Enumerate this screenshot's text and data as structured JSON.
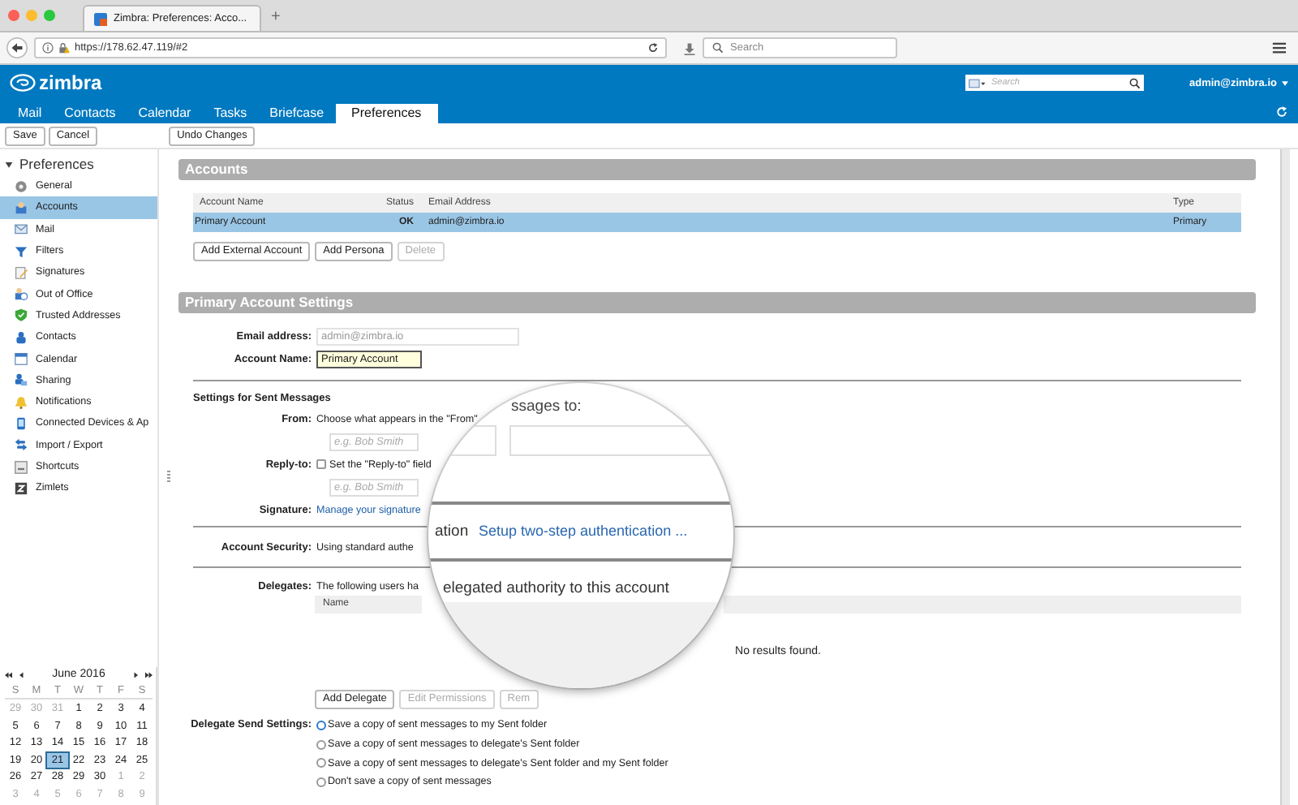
{
  "browser": {
    "tab_title": "Zimbra: Preferences: Acco...",
    "new_tab": "+",
    "url": "https://178.62.47.119/#2",
    "search_placeholder": "Search"
  },
  "header": {
    "logo": "zimbra",
    "search_placeholder": "Search",
    "user": "admin@zimbra.io"
  },
  "app_tabs": [
    {
      "label": "Mail",
      "selected": false
    },
    {
      "label": "Contacts",
      "selected": false
    },
    {
      "label": "Calendar",
      "selected": false
    },
    {
      "label": "Tasks",
      "selected": false
    },
    {
      "label": "Briefcase",
      "selected": false
    },
    {
      "label": "Preferences",
      "selected": true
    }
  ],
  "toolbar": {
    "buttons": [
      "Save",
      "Cancel"
    ],
    "undo": "Undo Changes"
  },
  "sidebar": {
    "title": "Preferences",
    "expanded": true,
    "items": [
      {
        "label": "General",
        "selected": false
      },
      {
        "label": "Accounts",
        "selected": true
      },
      {
        "label": "Mail",
        "selected": false
      },
      {
        "label": "Filters",
        "selected": false
      },
      {
        "label": "Signatures",
        "selected": false
      },
      {
        "label": "Out of Office",
        "selected": false
      },
      {
        "label": "Trusted Addresses",
        "selected": false
      },
      {
        "label": "Contacts",
        "selected": false
      },
      {
        "label": "Calendar",
        "selected": false
      },
      {
        "label": "Sharing",
        "selected": false
      },
      {
        "label": "Notifications",
        "selected": false
      },
      {
        "label": "Connected Devices & Ap",
        "selected": false
      },
      {
        "label": "Import / Export",
        "selected": false
      },
      {
        "label": "Shortcuts",
        "selected": false
      },
      {
        "label": "Zimlets",
        "selected": false
      }
    ]
  },
  "calendar": {
    "month": "June 2016",
    "weekdays": [
      "S",
      "M",
      "T",
      "W",
      "T",
      "F",
      "S"
    ],
    "weeks": [
      [
        {
          "d": "29",
          "muted": true,
          "selected": false
        },
        {
          "d": "30",
          "muted": true,
          "selected": false
        },
        {
          "d": "31",
          "muted": true,
          "selected": false
        },
        {
          "d": "1",
          "muted": false,
          "selected": false
        },
        {
          "d": "2",
          "muted": false,
          "selected": false
        },
        {
          "d": "3",
          "muted": false,
          "selected": false
        },
        {
          "d": "4",
          "muted": false,
          "selected": false
        }
      ],
      [
        {
          "d": "5",
          "muted": false,
          "selected": false
        },
        {
          "d": "6",
          "muted": false,
          "selected": false
        },
        {
          "d": "7",
          "muted": false,
          "selected": false
        },
        {
          "d": "8",
          "muted": false,
          "selected": false
        },
        {
          "d": "9",
          "muted": false,
          "selected": false
        },
        {
          "d": "10",
          "muted": false,
          "selected": false
        },
        {
          "d": "11",
          "muted": false,
          "selected": false
        }
      ],
      [
        {
          "d": "12",
          "muted": false,
          "selected": false
        },
        {
          "d": "13",
          "muted": false,
          "selected": false
        },
        {
          "d": "14",
          "muted": false,
          "selected": false
        },
        {
          "d": "15",
          "muted": false,
          "selected": false
        },
        {
          "d": "16",
          "muted": false,
          "selected": false
        },
        {
          "d": "17",
          "muted": false,
          "selected": false
        },
        {
          "d": "18",
          "muted": false,
          "selected": false
        }
      ],
      [
        {
          "d": "19",
          "muted": false,
          "selected": false
        },
        {
          "d": "20",
          "muted": false,
          "selected": false
        },
        {
          "d": "21",
          "muted": false,
          "selected": true
        },
        {
          "d": "22",
          "muted": false,
          "selected": false
        },
        {
          "d": "23",
          "muted": false,
          "selected": false
        },
        {
          "d": "24",
          "muted": false,
          "selected": false
        },
        {
          "d": "25",
          "muted": false,
          "selected": false
        }
      ],
      [
        {
          "d": "26",
          "muted": false,
          "selected": false
        },
        {
          "d": "27",
          "muted": false,
          "selected": false
        },
        {
          "d": "28",
          "muted": false,
          "selected": false
        },
        {
          "d": "29",
          "muted": false,
          "selected": false
        },
        {
          "d": "30",
          "muted": false,
          "selected": false
        },
        {
          "d": "1",
          "muted": true,
          "selected": false
        },
        {
          "d": "2",
          "muted": true,
          "selected": false
        }
      ],
      [
        {
          "d": "3",
          "muted": true,
          "selected": false
        },
        {
          "d": "4",
          "muted": true,
          "selected": false
        },
        {
          "d": "5",
          "muted": true,
          "selected": false
        },
        {
          "d": "6",
          "muted": true,
          "selected": false
        },
        {
          "d": "7",
          "muted": true,
          "selected": false
        },
        {
          "d": "8",
          "muted": true,
          "selected": false
        },
        {
          "d": "9",
          "muted": true,
          "selected": false
        }
      ]
    ]
  },
  "accounts": {
    "title": "Accounts",
    "columns": [
      "Account Name",
      "Status",
      "Email Address",
      "Type"
    ],
    "rows": [
      {
        "cells": [
          "Primary Account",
          "OK",
          "admin@zimbra.io",
          "Primary"
        ],
        "selected": true
      }
    ],
    "buttons": [
      {
        "label": "Add External Account",
        "disabled": false
      },
      {
        "label": "Add Persona",
        "disabled": false
      },
      {
        "label": "Delete",
        "disabled": true
      }
    ]
  },
  "settings": {
    "title": "Primary Account Settings",
    "email": {
      "label": "Email address:",
      "value": "admin@zimbra.io",
      "disabled": true
    },
    "account_name": {
      "label": "Account Name:",
      "value": "Primary Account"
    },
    "sent_heading": "Settings for Sent Messages",
    "from": {
      "label": "From:",
      "text": "Choose what appears in the \"From\"",
      "placeholder": "e.g. Bob Smith"
    },
    "reply_to": {
      "label": "Reply-to:",
      "checked": false,
      "text": "Set the \"Reply-to\" field",
      "placeholder": "e.g. Bob Smith"
    },
    "signature": {
      "label": "Signature:",
      "link": "Manage your signature"
    },
    "security": {
      "label": "Account Security:",
      "text": "Using standard authe"
    },
    "delegates": {
      "label": "Delegates:",
      "text": "The following users ha",
      "column": "Name",
      "empty": "No results found.",
      "buttons": [
        {
          "label": "Add Delegate",
          "disabled": false
        },
        {
          "label": "Edit Permissions",
          "disabled": true
        },
        {
          "label": "Rem",
          "disabled": true
        }
      ]
    },
    "send_settings": {
      "label": "Delegate Send Settings:",
      "options": [
        {
          "label": "Save a copy of sent messages to my Sent folder",
          "selected": true
        },
        {
          "label": "Save a copy of sent messages to delegate's Sent folder",
          "selected": false
        },
        {
          "label": "Save a copy of sent messages to delegate's Sent folder and my Sent folder",
          "selected": false
        },
        {
          "label": "Don't save a copy of sent messages",
          "selected": false
        }
      ]
    }
  },
  "magnifier": {
    "heading": "ssages to:",
    "security_tail": "ation",
    "link": "Setup two-step authentication ...",
    "delegates_text": "elegated authority to this account"
  }
}
